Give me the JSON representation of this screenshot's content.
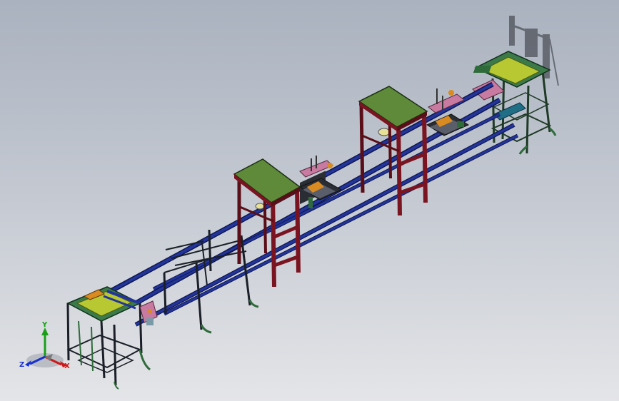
{
  "viewport": {
    "background_top": "#aab2bf",
    "background_bottom": "#e4e5e8"
  },
  "colors": {
    "rail": "#1e2e8a",
    "rail_dark": "#0f1850",
    "stand_frame": "#7a1420",
    "stand_top": "#5e8a3a",
    "frame_green": "#2f6b3a",
    "plate_yellow": "#b8c832",
    "accent_orange": "#d98a20",
    "accent_pink": "#c87aa0",
    "dark_steel": "#2a2d33"
  },
  "triad": {
    "x_label": "X",
    "y_label": "Y",
    "z_label": "Z",
    "x_color": "#d01818",
    "y_color": "#18a018",
    "z_color": "#1830d0"
  }
}
